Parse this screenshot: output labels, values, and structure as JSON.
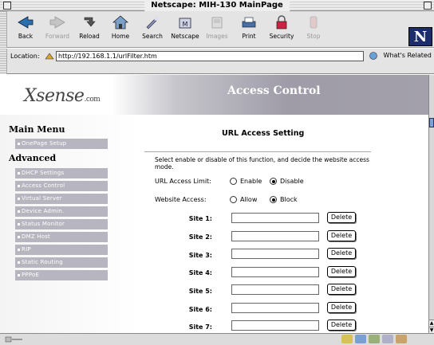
{
  "window": {
    "title": "Netscape: MIH-130 MainPage"
  },
  "toolbar": {
    "buttons": [
      {
        "label": "Back",
        "icon": "back-arrow-icon",
        "enabled": true
      },
      {
        "label": "Forward",
        "icon": "forward-arrow-icon",
        "enabled": false
      },
      {
        "label": "Reload",
        "icon": "reload-icon",
        "enabled": true
      },
      {
        "label": "Home",
        "icon": "home-icon",
        "enabled": true
      },
      {
        "label": "Search",
        "icon": "search-icon",
        "enabled": true
      },
      {
        "label": "Netscape",
        "icon": "netscape-icon",
        "enabled": true
      },
      {
        "label": "Images",
        "icon": "images-icon",
        "enabled": false
      },
      {
        "label": "Print",
        "icon": "print-icon",
        "enabled": true
      },
      {
        "label": "Security",
        "icon": "security-lock-icon",
        "enabled": true
      },
      {
        "label": "Stop",
        "icon": "stop-icon",
        "enabled": false
      }
    ],
    "logo": "N"
  },
  "location": {
    "label": "Location:",
    "url": "http://192.168.1.1/urlFilter.htm",
    "related_label": "What's Related"
  },
  "page": {
    "logo_text": "Xsense",
    "logo_suffix": ".com",
    "banner_title": "Access Control",
    "sidebar": {
      "main_menu_title": "Main Menu",
      "main_items": [
        "OnePage Setup"
      ],
      "advanced_title": "Advanced",
      "advanced_items": [
        "DHCP Settings",
        "Access Control",
        "Virtual Server",
        "Device Admin.",
        "Status Monitor",
        "DMZ Host",
        "RIP",
        "Static Routing",
        "PPPoE"
      ]
    },
    "form": {
      "heading": "URL Access Setting",
      "description": "Select enable or disable of this function, and decide the website access mode.",
      "limit_label": "URL Access Limit:",
      "limit_options": [
        "Enable",
        "Disable"
      ],
      "limit_selected": "Disable",
      "website_label": "Website Access:",
      "website_options": [
        "Allow",
        "Block"
      ],
      "website_selected": "Block",
      "sites": [
        {
          "label": "Site 1:",
          "value": ""
        },
        {
          "label": "Site 2:",
          "value": ""
        },
        {
          "label": "Site 3:",
          "value": ""
        },
        {
          "label": "Site 4:",
          "value": ""
        },
        {
          "label": "Site 5:",
          "value": ""
        },
        {
          "label": "Site 6:",
          "value": ""
        },
        {
          "label": "Site 7:",
          "value": ""
        }
      ],
      "delete_label": "Delete"
    }
  },
  "colors": {
    "menu_item_bg": "#b7b5bf",
    "banner_accent": "#9f9ca8",
    "netscape_logo_bg": "#1d2d6a"
  }
}
